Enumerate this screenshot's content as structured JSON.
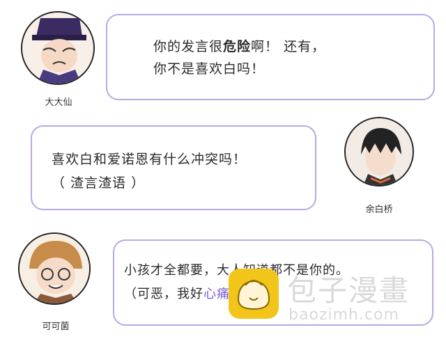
{
  "messages": [
    {
      "speaker": "大大仙",
      "lines": [
        "你的发言很",
        "危险",
        "啊！ 还有，",
        "你不是喜欢白吗！"
      ]
    },
    {
      "speaker": "余白桥",
      "lines": [
        "喜欢白和爱诺恩有什么冲突吗！",
        "（ 渣言渣语 ）"
      ]
    },
    {
      "speaker": "可可菌",
      "lines": [
        "小孩才全都要，大人知道都不是你的。",
        "（可恶，我好",
        "心痛",
        "！）"
      ]
    }
  ],
  "watermark": {
    "brand": "包子漫畫",
    "url": "baozimh.com"
  },
  "colors": {
    "bubble_border": "#b9a7e6",
    "text": "#2a2a2a",
    "watermark_logo": "#f2c51b",
    "watermark_text": "#d9d9d9"
  }
}
